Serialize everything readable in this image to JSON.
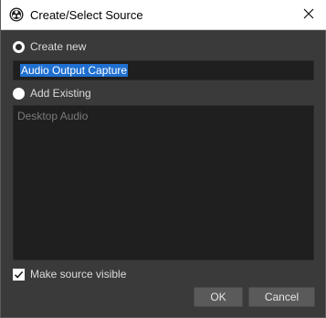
{
  "window": {
    "title": "Create/Select Source"
  },
  "create_new": {
    "label": "Create new",
    "selected": true
  },
  "name_input": {
    "value": "Audio Output Capture"
  },
  "add_existing": {
    "label": "Add Existing",
    "selected": false
  },
  "existing_list": {
    "items": [
      "Desktop Audio"
    ]
  },
  "make_visible": {
    "label": "Make source visible",
    "checked": true
  },
  "buttons": {
    "ok": "OK",
    "cancel": "Cancel"
  },
  "icons": {
    "app": "obs-logo-icon",
    "close": "close-icon",
    "check": "checkmark-icon"
  },
  "colors": {
    "selection": "#1e6fd0",
    "background": "#3a3a3a",
    "field": "#1f1f1f"
  }
}
